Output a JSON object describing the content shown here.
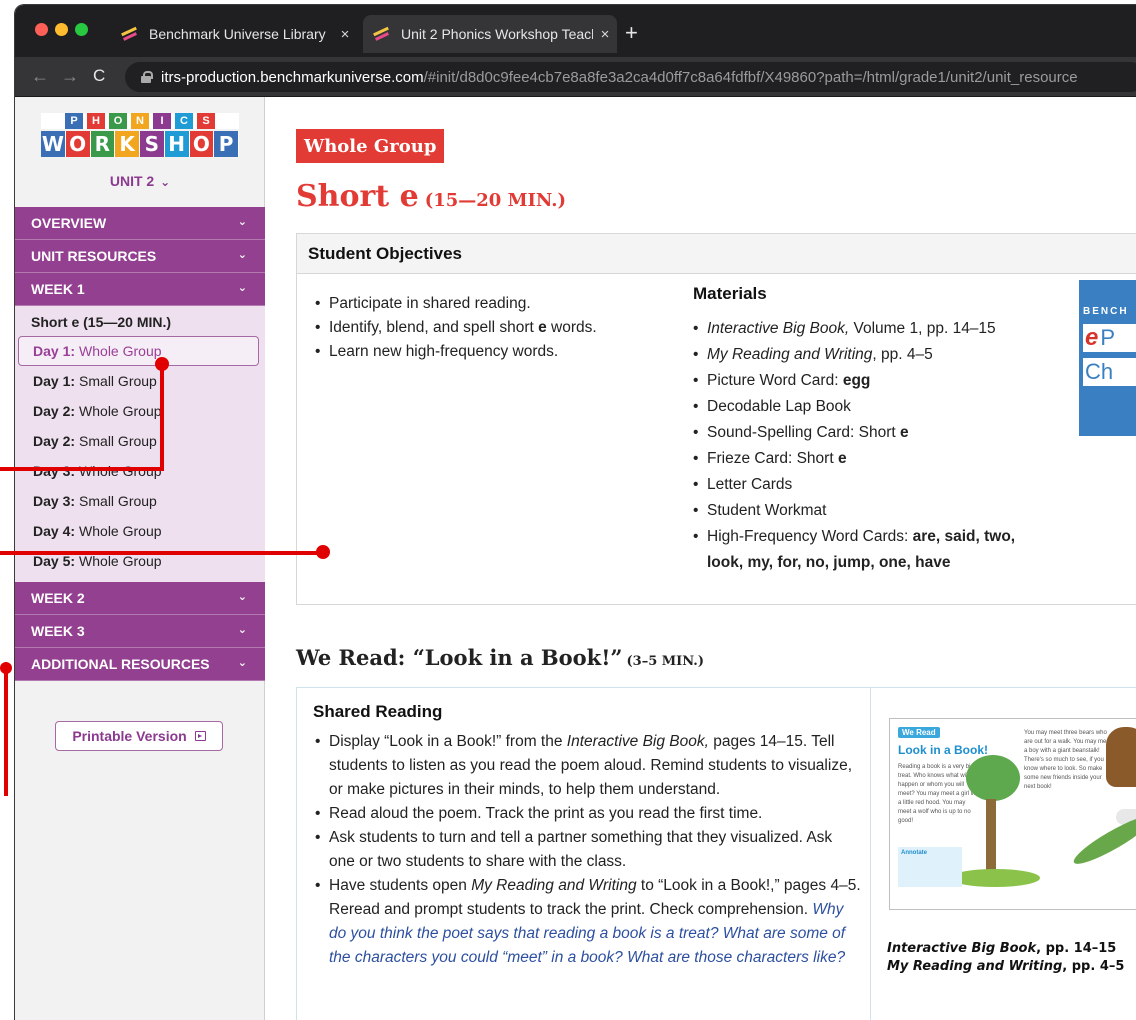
{
  "browser": {
    "tabs": [
      {
        "title": "Benchmark Universe Library",
        "close": "×"
      },
      {
        "title": "Unit 2 Phonics Workshop Teach",
        "close": "×"
      }
    ],
    "new_tab": "+",
    "back": "←",
    "forward": "→",
    "reload": "C",
    "url_host": "itrs-production.benchmarkuniverse.com",
    "url_path": "/#init/d8d0c9fee4cb7e8a8fe3a2ca4d0ff7c8a64fdfbf/X49860?path=/html/grade1/unit2/unit_resource"
  },
  "sidebar": {
    "logo_top": [
      "P",
      "H",
      "O",
      "N",
      "I",
      "C",
      "S"
    ],
    "logo_bottom": [
      "W",
      "O",
      "R",
      "K",
      "S",
      "H",
      "O",
      "P"
    ],
    "logo_colors": [
      "#3a6fb5",
      "#e23b36",
      "#3a9a4a",
      "#f2a51f",
      "#8b3a8f",
      "#1f9bd6",
      "#e23b36",
      "#3a6fb5"
    ],
    "unit_label": "UNIT 2",
    "unit_chevron": "⌄",
    "menu": [
      {
        "label": "OVERVIEW"
      },
      {
        "label": "UNIT RESOURCES"
      },
      {
        "label": "WEEK 1"
      }
    ],
    "week1_heading": "Short e (15—20 MIN.)",
    "days": [
      {
        "day": "Day 1:",
        "group": "Whole Group",
        "active": true
      },
      {
        "day": "Day 1:",
        "group": "Small Group"
      },
      {
        "day": "Day 2:",
        "group": "Whole Group"
      },
      {
        "day": "Day 2:",
        "group": "Small Group"
      },
      {
        "day": "Day 3:",
        "group": "Whole Group"
      },
      {
        "day": "Day 3:",
        "group": "Small Group"
      },
      {
        "day": "Day 4:",
        "group": "Whole Group"
      },
      {
        "day": "Day 5:",
        "group": "Whole Group"
      }
    ],
    "menu_after": [
      {
        "label": "WEEK 2"
      },
      {
        "label": "WEEK 3"
      },
      {
        "label": "ADDITIONAL RESOURCES"
      }
    ],
    "printable_label": "Printable Version"
  },
  "main": {
    "badge": "Whole Group",
    "title": "Short e",
    "title_time": "(15—20 MIN.)",
    "objectives_heading": "Student Objectives",
    "objectives": [
      "Participate in shared reading.",
      "Identify, blend, and spell short e words.",
      "Learn new high-frequency words."
    ],
    "materials_heading": "Materials",
    "materials": [
      {
        "em": "Interactive Big Book,",
        "text": " Volume 1, pp. 14–15"
      },
      {
        "em": "My Reading and Writing",
        "text": ", pp. 4–5"
      },
      {
        "text": "Picture Word Card: ",
        "bold": "egg"
      },
      {
        "text": "Decodable Lap Book"
      },
      {
        "text": "Sound-Spelling Card: Short ",
        "bold": "e"
      },
      {
        "text": "Frieze Card: Short ",
        "bold": "e"
      },
      {
        "text": "Letter Cards"
      },
      {
        "text": "Student Workmat"
      },
      {
        "text": "High-Frequency Word Cards: ",
        "bold": "are, said, two, look, my, for, no, jump, one, have"
      }
    ],
    "echeck": {
      "bench": "BENCH",
      "line1_e": "e",
      "line1_rest": "P",
      "line2": "Ch"
    },
    "read_title": "We Read: “Look in a Book!”",
    "read_time": "(3–5 MIN.)",
    "shared_heading": "Shared Reading",
    "shared": {
      "b1_a": "Display “Look in a Book!” from the ",
      "b1_em": "Interactive Big Book,",
      "b1_b": " pages 14–15. Tell students to listen as you read the poem aloud. Remind students to visualize, or make pictures in their minds, to help them understand.",
      "b2": "Read aloud the poem. Track the print as you read the first time.",
      "b3": "Ask students to turn and tell a partner something that they visualized. Ask one or two students to share with the class.",
      "b4_a": "Have students open ",
      "b4_em": "My Reading and Writing",
      "b4_b": " to “Look in a Book!,” pages 4–5. Reread and prompt students to track the print. Check comprehension. ",
      "b4_q": "Why do you think the poet says that reading a book is a treat? What are some of the characters you could “meet” in a book? What are those characters like?"
    },
    "book": {
      "tag": "We Read",
      "title": "Look in a Book!",
      "text_left": "Reading a book is a very big treat. Who knows what will happen or whom you will meet? You may meet a girl in a little red hood. You may meet a wolf who is up to no good!",
      "text_right": "You may meet three bears who are out for a walk. You may meet a boy with a giant beanstalk! There's so much to see, if you know where to look. So make some new friends inside your next book!",
      "annotate": "Annotate"
    },
    "caption_1_em": "Interactive Big Book",
    "caption_1_pp": ", pp. 14–15",
    "caption_2_em": "My Reading and Writing",
    "caption_2_pp": ", pp. 4–5"
  },
  "colors": {
    "accent_purple": "#92408f",
    "accent_red": "#e23b36",
    "callout_red": "#e00000",
    "question_blue": "#2d4fa0"
  }
}
